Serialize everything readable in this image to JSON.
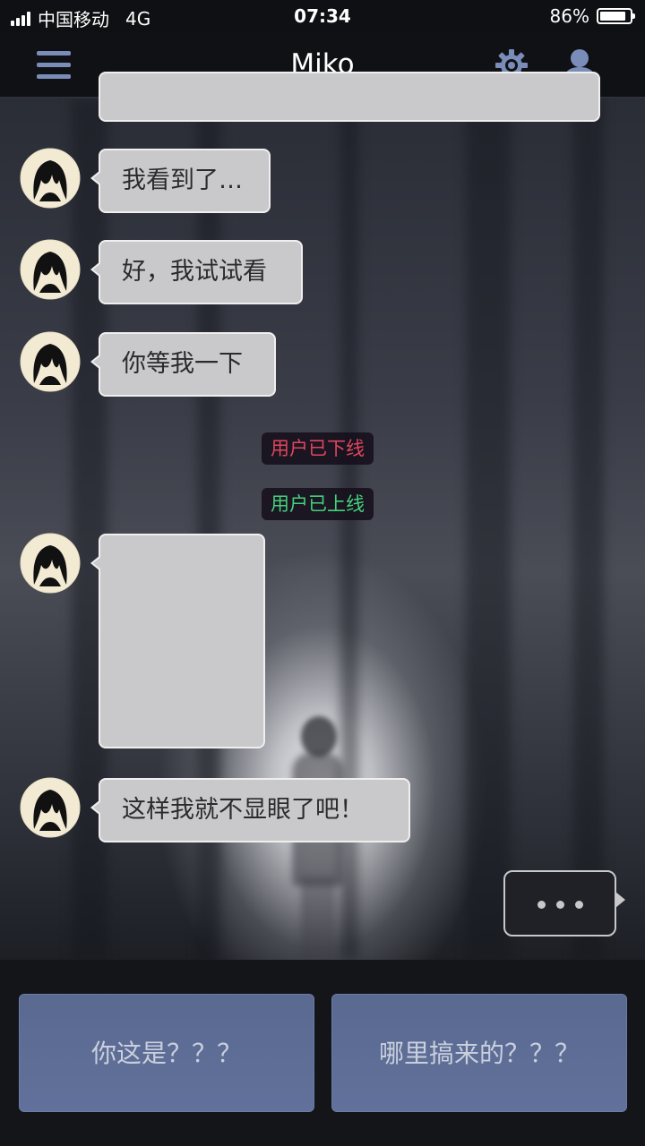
{
  "status_bar": {
    "carrier": "中国移动",
    "network": "4G",
    "time": "07:34",
    "battery": "86%",
    "battery_level": 0.86
  },
  "header": {
    "title": "Miko"
  },
  "messages": [
    {
      "id": "m1",
      "text": "我看到了…"
    },
    {
      "id": "m2",
      "text": "好，我试试看"
    },
    {
      "id": "m3",
      "text": "你等我一下"
    },
    {
      "id": "m4",
      "text": ""
    },
    {
      "id": "m5",
      "text": "这样我就不显眼了吧！"
    }
  ],
  "system_notices": [
    {
      "text": "用户已下线",
      "color": "#e0465f"
    },
    {
      "text": "用户已上线",
      "color": "#44d17c"
    }
  ],
  "choices": [
    {
      "label": "你这是？？？"
    },
    {
      "label": "哪里搞来的？？？"
    }
  ],
  "colors": {
    "accent_icon": "#7a8db8",
    "bubble": "#c9c9cb",
    "choice_button": "#5e6e98"
  }
}
